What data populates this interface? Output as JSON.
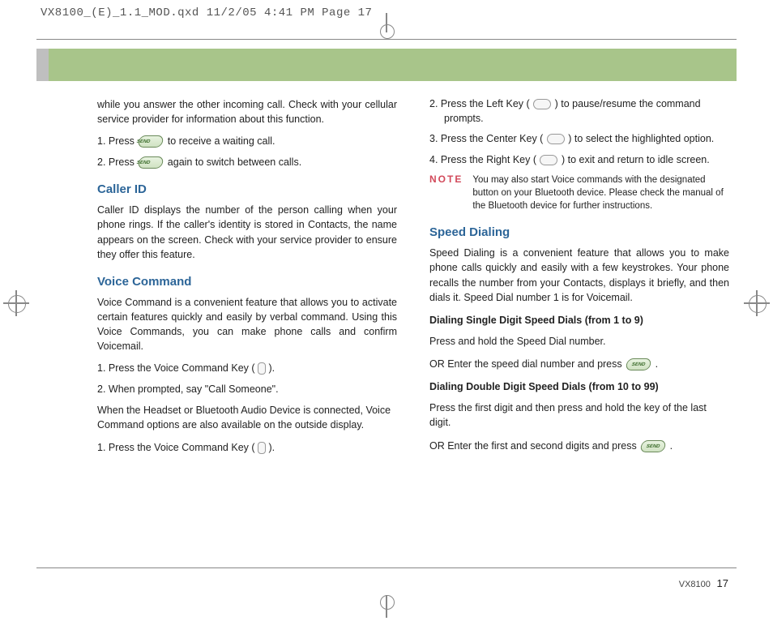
{
  "print_header": "VX8100_(E)_1.1_MOD.qxd  11/2/05  4:41 PM  Page 17",
  "left": {
    "intro": "while you answer the other incoming call. Check with your cellular service provider for information about this function.",
    "s1": "1.  Press ",
    "s1b": "  to receive a waiting call.",
    "s2": "2.  Press ",
    "s2b": "  again to switch between calls.",
    "caller_id_h": "Caller ID",
    "caller_id_p": "Caller ID displays the number of the person calling when your phone rings. If the caller's identity is stored in Contacts, the name appears on the screen. Check with your service provider to ensure they offer this feature.",
    "voice_h": "Voice Command",
    "voice_p": "Voice Command is a convenient feature that allows you to activate certain features quickly and easily by verbal command. Using this Voice Commands, you can make phone calls and confirm Voicemail.",
    "vc1a": "1.  Press the Voice Command Key ( ",
    "vc1b": " ).",
    "vc2": "2.  When prompted, say \"Call Someone\".",
    "vc_headset": "When the Headset or Bluetooth Audio Device is connected, Voice Command options are also available on the outside display.",
    "vc3a": "1. Press the Voice Command Key ( ",
    "vc3b": " )."
  },
  "right": {
    "r2a": "2.  Press the Left Key ( ",
    "r2b": " ) to pause/resume the command prompts.",
    "r3a": "3.  Press the Center Key ( ",
    "r3b": " ) to select the highlighted option.",
    "r4a": "4.  Press the Right Key ( ",
    "r4b": " ) to exit and return to idle screen.",
    "note_label": "NOTE",
    "note_text": "You may also start Voice commands with the designated button on your Bluetooth device. Please check the manual of the Bluetooth device for further instructions.",
    "speed_h": "Speed Dialing",
    "speed_p": "Speed Dialing is a convenient feature that allows you to make phone calls quickly and easily with a few keystrokes. Your phone recalls the number from your Contacts, displays it briefly, and then dials it. Speed Dial number 1 is for Voicemail.",
    "sd_single_h": "Dialing Single Digit Speed Dials (from 1 to 9)",
    "sd_single_1": "Press and hold the Speed Dial number.",
    "sd_single_2a": "OR   Enter the speed dial number and press  ",
    "sd_single_2b": "  .",
    "sd_double_h": "Dialing Double Digit Speed Dials (from 10 to 99)",
    "sd_double_1": "Press the first digit and then press and hold the key of the last digit.",
    "sd_double_2a": "OR   Enter the first and second digits and press  ",
    "sd_double_2b": "  ."
  },
  "footer_model": "VX8100",
  "footer_page": "17",
  "send_label": "SEND"
}
